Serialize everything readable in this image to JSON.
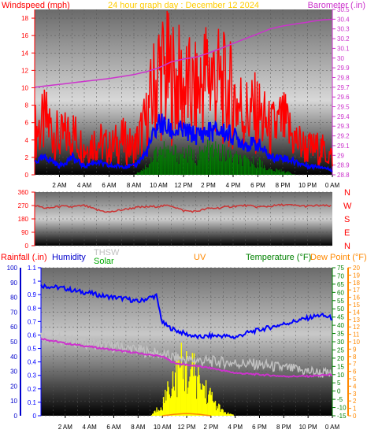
{
  "header": {
    "windspeed": "Windspeed (mph)",
    "graph_day": "24 hour graph day : December 12 2024",
    "barometer": "Barometer (.in)"
  },
  "time_labels": [
    "2 AM",
    "4 AM",
    "6 AM",
    "8 AM",
    "10 AM",
    "12 PM",
    "2 PM",
    "4 PM",
    "6 PM",
    "8 PM",
    "10 PM",
    "0 AM"
  ],
  "compass": [
    "N",
    "W",
    "S",
    "E",
    "N"
  ],
  "bottom_header": {
    "rainfall": "Rainfall (.in)",
    "humidity": "Humidity",
    "thsw": "THSW",
    "solar": "Solar",
    "uv": "UV",
    "temperature": "Temperature (°F)",
    "dewpoint": "Dew Point (°F)"
  },
  "colors": {
    "windspeed": "#ff0000",
    "wind_avg": "#0000ff",
    "wind_green": "#008000",
    "barometer": "#cc33cc",
    "direction": "#cc3333",
    "humidity": "#0000ff",
    "thsw": "#c0c0c0",
    "temperature": "#cc33cc",
    "solar": "#ffff00",
    "uv": "#ff8800",
    "rain_axis": "#0000ff",
    "temp_axis": "#008000",
    "dew_axis": "#ff8800"
  },
  "chart_data": [
    {
      "type": "line",
      "panel": "wind-barometer",
      "x_unit": "hours since midnight",
      "xlim": [
        0,
        24
      ],
      "left_axis": {
        "label": "Windspeed (mph)",
        "ylim": [
          0,
          19
        ],
        "ticks": [
          "0",
          "2",
          "4",
          "6",
          "8",
          "10",
          "12",
          "14",
          "16",
          "18"
        ]
      },
      "right_axis": {
        "label": "Barometer (.in)",
        "ylim": [
          28.8,
          30.5
        ],
        "ticks": [
          "28.8",
          "28.9",
          "29",
          "29.1",
          "29.2",
          "29.3",
          "29.4",
          "29.5",
          "29.6",
          "29.7",
          "29.8",
          "29.9",
          "30",
          "30.1",
          "30.2",
          "30.3",
          "30.4",
          "30.5"
        ]
      },
      "series": [
        {
          "name": "Barometer (.in)",
          "axis": "right",
          "x": [
            0,
            2,
            4,
            6,
            8,
            9,
            10,
            11,
            12,
            13,
            14,
            15,
            16,
            17,
            18,
            19,
            20,
            21,
            22,
            23,
            24
          ],
          "values": [
            29.7,
            29.73,
            29.76,
            29.79,
            29.83,
            29.86,
            29.9,
            29.96,
            29.99,
            30.01,
            30.05,
            30.1,
            30.15,
            30.2,
            30.25,
            30.3,
            30.33,
            30.35,
            30.37,
            30.39,
            30.4
          ]
        },
        {
          "name": "Windspeed (mph)",
          "axis": "left",
          "x": [
            0,
            1,
            2,
            3,
            4,
            5,
            6,
            7,
            8,
            9,
            10,
            11,
            12,
            13,
            14,
            15,
            16,
            17,
            18,
            19,
            20,
            21,
            22,
            23,
            24
          ],
          "values": [
            5,
            6,
            4,
            5,
            3,
            4,
            3,
            4,
            3,
            6,
            12,
            11,
            10,
            9,
            12,
            10,
            9,
            7,
            7,
            5,
            6,
            4,
            3,
            3,
            2
          ]
        },
        {
          "axis": "left",
          "x": [
            0,
            1,
            2,
            3,
            4,
            5,
            6,
            7,
            8,
            9,
            10,
            11,
            12,
            13,
            14,
            15,
            16,
            17,
            18,
            19,
            20,
            21,
            22,
            23,
            24
          ],
          "values": [
            1.5,
            2,
            1,
            2,
            1,
            1.5,
            1,
            1,
            1,
            2.5,
            6,
            5,
            5,
            4.5,
            5,
            5,
            4.5,
            3.5,
            3.5,
            2,
            2,
            1.5,
            1,
            1,
            0.5
          ]
        },
        {
          "axis": "left",
          "x": [
            0,
            1,
            2,
            3,
            4,
            5,
            6,
            7,
            8,
            9,
            10,
            11,
            12,
            13,
            14,
            15,
            16,
            17,
            18,
            19,
            20,
            21,
            22,
            23,
            24
          ],
          "values": [
            0,
            0,
            0,
            0,
            0,
            0,
            0,
            0,
            0,
            1,
            3,
            2.5,
            2.5,
            2,
            3,
            2.5,
            2,
            1.5,
            1.5,
            0.5,
            0.5,
            0,
            0,
            0,
            0
          ]
        }
      ]
    },
    {
      "type": "line",
      "panel": "wind-direction",
      "x_unit": "hours since midnight",
      "xlim": [
        0,
        24
      ],
      "ylim": [
        0,
        360
      ],
      "ticks": [
        "0",
        "90",
        "180",
        "270",
        "360"
      ],
      "series": [
        {
          "x": [
            0,
            1,
            2,
            3,
            4,
            5,
            6,
            7,
            8,
            9,
            10,
            11,
            12,
            13,
            14,
            15,
            16,
            17,
            18,
            19,
            20,
            21,
            22,
            23,
            24
          ],
          "values": [
            270,
            250,
            265,
            260,
            270,
            240,
            225,
            240,
            255,
            260,
            265,
            270,
            235,
            230,
            250,
            255,
            265,
            270,
            260,
            265,
            275,
            270,
            265,
            270,
            265
          ]
        }
      ]
    },
    {
      "type": "line",
      "panel": "temp-humidity",
      "x_unit": "hours since midnight",
      "xlim": [
        0,
        24
      ],
      "axes": {
        "rainfall": {
          "label": "Rainfall (.in)",
          "ylim": [
            0,
            1.1
          ],
          "ticks": [
            "0",
            "0.1",
            "0.2",
            "0.3",
            "0.4",
            "0.5",
            "0.6",
            "0.7",
            "0.8",
            "0.9",
            "1",
            "1.1"
          ]
        },
        "humidity": {
          "label": "Humidity",
          "ylim": [
            0,
            100
          ],
          "ticks": [
            "0",
            "10",
            "20",
            "30",
            "40",
            "50",
            "60",
            "70",
            "80",
            "90",
            "100"
          ]
        },
        "temperature": {
          "label": "Temperature (°F)",
          "ylim": [
            -15,
            75
          ],
          "ticks": [
            "-15",
            "-10",
            "-5",
            "0",
            "5",
            "10",
            "15",
            "20",
            "25",
            "30",
            "35",
            "40",
            "45",
            "50",
            "55",
            "60",
            "65",
            "70",
            "75"
          ]
        },
        "dewpoint": {
          "label": "Dew Point (°F)",
          "ylim": [
            0,
            20
          ],
          "ticks": [
            "0",
            "1",
            "2",
            "3",
            "4",
            "5",
            "6",
            "7",
            "8",
            "9",
            "10",
            "11",
            "12",
            "13",
            "14",
            "15",
            "16",
            "17",
            "18",
            "19",
            "20"
          ]
        }
      },
      "series": [
        {
          "name": "Humidity",
          "axis": "humidity",
          "x": [
            0,
            1,
            2,
            3,
            4,
            5,
            6,
            7,
            8,
            9,
            9.5,
            10,
            10.5,
            11,
            12,
            13,
            14,
            15,
            16,
            17,
            18,
            19,
            20,
            21,
            22,
            23,
            24
          ],
          "values": [
            88,
            87,
            86,
            84,
            83,
            81,
            80,
            79,
            77,
            80,
            81,
            63,
            60,
            58,
            55,
            53,
            54,
            54,
            53,
            56,
            58,
            60,
            62,
            64,
            66,
            68,
            66
          ]
        },
        {
          "name": "THSW",
          "axis": "temperature",
          "x": [
            0,
            2,
            4,
            6,
            8,
            10,
            12,
            14,
            16,
            18,
            20,
            22,
            24
          ],
          "values": [
            34,
            31,
            29,
            27,
            25,
            22,
            19,
            18,
            17,
            16,
            14,
            12,
            10
          ]
        },
        {
          "name": "Temperature (°F)",
          "axis": "temperature",
          "x": [
            0,
            2,
            4,
            6,
            8,
            10,
            11,
            12,
            14,
            16,
            18,
            20,
            22,
            24
          ],
          "values": [
            32,
            29,
            27,
            25,
            23,
            21,
            17,
            16,
            14,
            11,
            10,
            9,
            9,
            10
          ]
        },
        {
          "name": "Solar",
          "axis": "humidity",
          "x": [
            9,
            10,
            10.5,
            11,
            11.5,
            12,
            12.5,
            13,
            13.5,
            14,
            14.5,
            15,
            16
          ],
          "values": [
            0,
            10,
            25,
            32,
            40,
            38,
            35,
            28,
            22,
            15,
            8,
            3,
            0
          ]
        },
        {
          "name": "UV",
          "axis": "dewpoint",
          "x": [
            10,
            11,
            12,
            13,
            14
          ],
          "values": [
            0,
            0.2,
            0.3,
            0.2,
            0
          ]
        }
      ]
    }
  ]
}
